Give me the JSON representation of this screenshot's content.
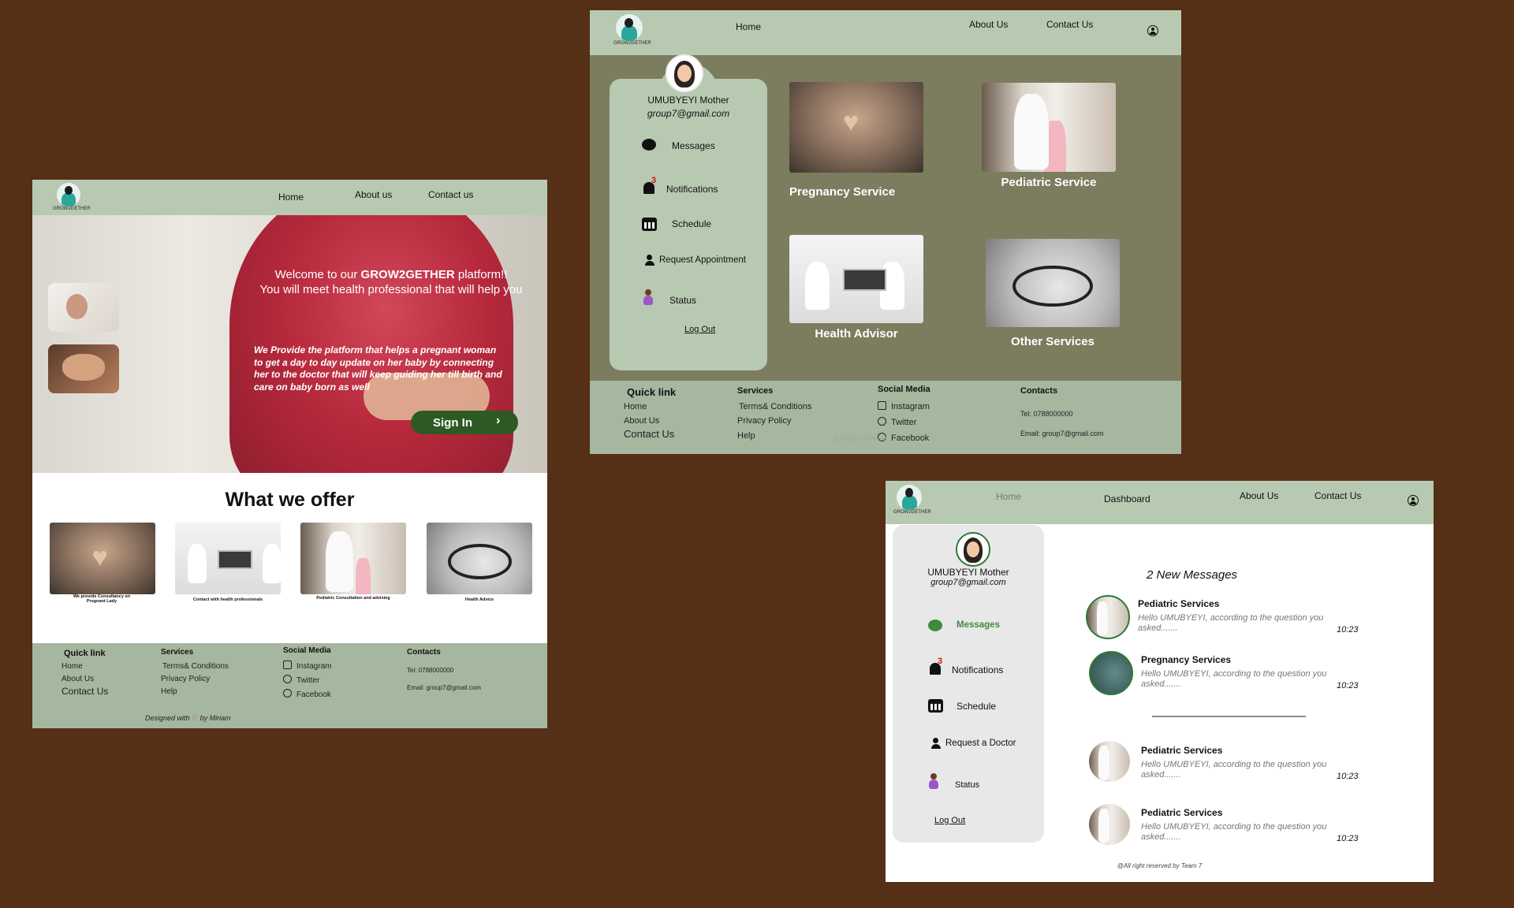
{
  "brand": {
    "name": "GROW2GETHER"
  },
  "landing": {
    "nav": {
      "home": "Home",
      "about": "About us",
      "contact": "Contact us"
    },
    "hero": {
      "welcome_prefix": "Welcome to our ",
      "welcome_brand": "GROW2GETHER",
      "welcome_suffix": " platform!!",
      "welcome_line2": "You will meet health professional that will help you",
      "description": "We Provide the platform that helps a pregnant woman to get a day to day update on her baby by connecting her to the doctor that will keep guiding her till birth and care on baby born as well",
      "signin_label": "Sign In"
    },
    "offer": {
      "title": "What we offer",
      "cards": [
        {
          "caption": "We provide Consultancy on Pregnant Lady"
        },
        {
          "caption": "Contact with health professionals"
        },
        {
          "caption": "Pediatric Consultation and advising"
        },
        {
          "caption": "Health Advice"
        }
      ]
    },
    "footer": {
      "quick_link": "Quick link",
      "links": [
        "Home",
        "About Us",
        "Contact Us"
      ],
      "services": "Services",
      "service_items": [
        "Terms& Conditions",
        "Privacy Policy",
        "Help"
      ],
      "social": "Social Media",
      "social_items": [
        "Instagram",
        "Twitter",
        "Facebook"
      ],
      "contacts": "Contacts",
      "tel": "Tel: 0788000000",
      "email": "Email: group7@gmail.com",
      "designed_prefix": "Designed with",
      "designed_suffix": "by Miriam"
    }
  },
  "services_page": {
    "nav": {
      "home": "Home",
      "about": "About Us",
      "contact": "Contact Us"
    },
    "profile": {
      "name": "UMUBYEYI Mother",
      "email": "group7@gmail.com"
    },
    "menu": {
      "messages": "Messages",
      "notifications": "Notifications",
      "notification_count": "3",
      "schedule": "Schedule",
      "request": "Request Appointment",
      "status": "Status",
      "logout": "Log Out"
    },
    "services": [
      {
        "label": "Pregnancy Service"
      },
      {
        "label": "Pediatric Service"
      },
      {
        "label": "Health Advisor"
      },
      {
        "label": "Other Services"
      }
    ],
    "footer": {
      "quick_link": "Quick link",
      "links": [
        "Home",
        "About Us",
        "Contact Us"
      ],
      "services": "Services",
      "service_items": [
        "Terms& Conditions",
        "Privacy Policy",
        "Help"
      ],
      "social": "Social Media",
      "social_items": [
        "Instagram",
        "Twitter",
        "Facebook"
      ],
      "contacts": "Contacts",
      "tel": "Tel: 0788000000",
      "email": "Email: group7@gmail.com",
      "watermark": "@All right reserved by Team 7"
    }
  },
  "messages_page": {
    "nav": {
      "home": "Home",
      "dashboard": "Dashboard",
      "about": "About Us",
      "contact": "Contact Us"
    },
    "profile": {
      "name": "UMUBYEYI Mother",
      "email": "group7@gmail.com"
    },
    "menu": {
      "messages": "Messages",
      "notifications": "Notifications",
      "notification_count": "3",
      "schedule": "Schedule",
      "request": "Request a Doctor",
      "status": "Status",
      "logout": "Log Out"
    },
    "heading": "2 New Messages",
    "messages": [
      {
        "title": "Pediatric Services",
        "body": "Hello UMUBYEYI, according to the question you asked.......",
        "time": "10:23"
      },
      {
        "title": "Pregnancy Services",
        "body": "Hello UMUBYEYI, according to the question you asked.......",
        "time": "10:23"
      },
      {
        "title": "Pediatric Services",
        "body": "Hello UMUBYEYI, according to the question you asked.......",
        "time": "10:23"
      },
      {
        "title": "Pediatric Services",
        "body": "Hello UMUBYEYI, according to the question you asked.......",
        "time": "10:23"
      }
    ],
    "copyright": "@All right reserved by Team 7"
  },
  "colors": {
    "background": "#552f16",
    "nav": "#b8c9b1",
    "olive": "#7c7c5f",
    "signin": "#2d5a23",
    "accent_green": "#3f8a3c"
  }
}
